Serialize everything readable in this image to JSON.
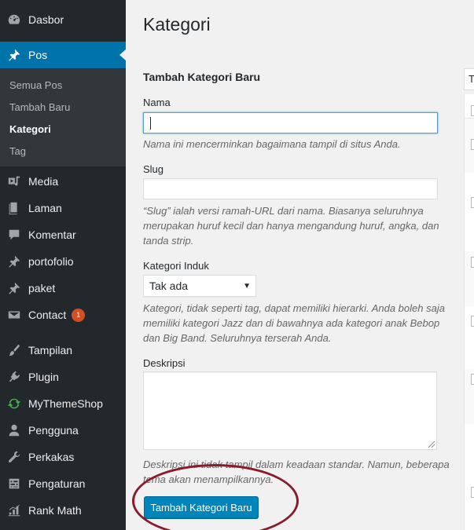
{
  "sidebar": {
    "items": [
      {
        "label": "Dasbor",
        "icon": "dashboard-icon"
      },
      {
        "label": "Pos",
        "icon": "pin-icon"
      },
      {
        "label": "Media",
        "icon": "media-icon"
      },
      {
        "label": "Laman",
        "icon": "page-icon"
      },
      {
        "label": "Komentar",
        "icon": "comment-icon"
      },
      {
        "label": "portofolio",
        "icon": "pin-icon"
      },
      {
        "label": "paket",
        "icon": "pin-icon"
      },
      {
        "label": "Contact",
        "icon": "mail-icon",
        "badge": "1"
      },
      {
        "label": "Tampilan",
        "icon": "brush-icon"
      },
      {
        "label": "Plugin",
        "icon": "plugin-icon"
      },
      {
        "label": "MyThemeShop",
        "icon": "refresh-icon"
      },
      {
        "label": "Pengguna",
        "icon": "user-icon"
      },
      {
        "label": "Perkakas",
        "icon": "wrench-icon"
      },
      {
        "label": "Pengaturan",
        "icon": "settings-icon"
      },
      {
        "label": "Rank Math",
        "icon": "chart-icon"
      }
    ],
    "submenu": [
      "Semua Pos",
      "Tambah Baru",
      "Kategori",
      "Tag"
    ],
    "active_color": "#0073aa",
    "badge_color": "#d54e21"
  },
  "main": {
    "title": "Kategori",
    "form_heading": "Tambah Kategori Baru",
    "name_label": "Nama",
    "name_value": "",
    "name_hint": "Nama ini mencerminkan bagaimana tampil di situs Anda.",
    "slug_label": "Slug",
    "slug_value": "",
    "slug_hint": "“Slug” ialah versi ramah-URL dari nama. Biasanya seluruhnya merupakan huruf kecil dan hanya mengandung huruf, angka, dan tanda strip.",
    "parent_label": "Kategori Induk",
    "parent_selected": "Tak ada",
    "parent_hint": "Kategori, tidak seperti tag, dapat memiliki hierarki. Anda boleh saja memiliki kategori Jazz dan di bawahnya ada kategori anak Bebop dan Big Band. Seluruhnya terserah Anda.",
    "desc_label": "Deskripsi",
    "desc_value": "",
    "desc_hint": "Deskripsi ini tidak tampil dalam keadaan standar. Namun, beberapa tema akan menampilkannya.",
    "submit_label": "Tambah Kategori Baru",
    "button_color": "#0085ba",
    "highlight_color": "#8a1b2b"
  },
  "right_panel": {
    "input_fragment": "T"
  }
}
